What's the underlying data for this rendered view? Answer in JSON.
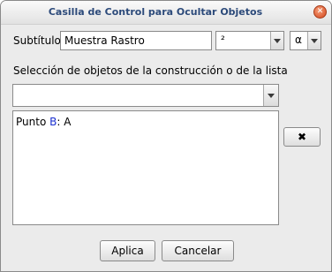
{
  "window": {
    "title": "Casilla de Control para Ocultar Objetos",
    "close_glyph": "✕"
  },
  "subtitle": {
    "label": "Subtítulo:",
    "value": "Muestra Rastro",
    "superscript_combo_value": "²",
    "greek_combo_value": "α"
  },
  "selection": {
    "label": "Selección de objetos de la construcción o de la lista",
    "selected_value": ""
  },
  "object_list": {
    "items": [
      {
        "prefix": "Punto ",
        "name": "B",
        "suffix": ": A"
      }
    ]
  },
  "remove_button": {
    "label": "✖"
  },
  "buttons": {
    "apply": "Aplica",
    "cancel": "Cancelar"
  }
}
